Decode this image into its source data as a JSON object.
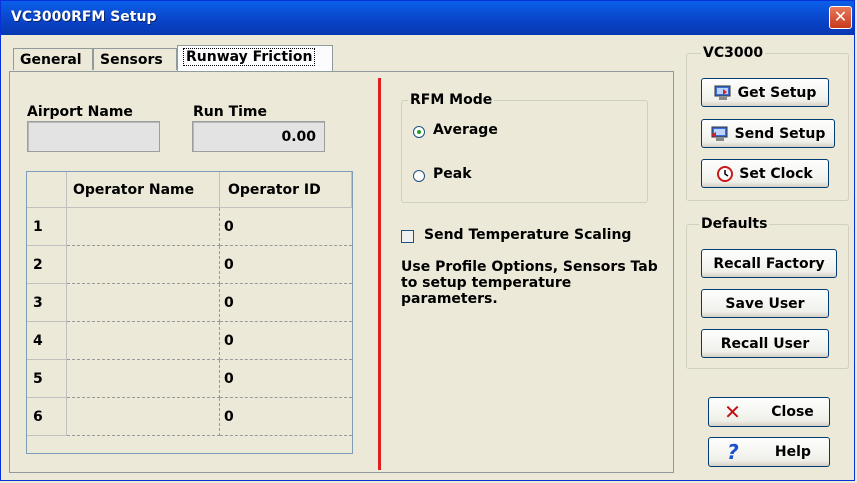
{
  "window": {
    "title": "VC3000RFM Setup",
    "close_glyph": "✕"
  },
  "tabs": [
    {
      "label": "General"
    },
    {
      "label": "Sensors"
    },
    {
      "label": "Runway Friction",
      "selected": true
    }
  ],
  "airport": {
    "label": "Airport Name",
    "value": ""
  },
  "runtime": {
    "label": "Run Time",
    "value": "0.00"
  },
  "grid": {
    "columns": [
      "",
      "Operator Name",
      "Operator ID"
    ],
    "rows": [
      {
        "num": "1",
        "name": "",
        "id": "0"
      },
      {
        "num": "2",
        "name": "",
        "id": "0"
      },
      {
        "num": "3",
        "name": "",
        "id": "0"
      },
      {
        "num": "4",
        "name": "",
        "id": "0"
      },
      {
        "num": "5",
        "name": "",
        "id": "0"
      },
      {
        "num": "6",
        "name": "",
        "id": "0"
      }
    ]
  },
  "rfm_mode": {
    "title": "RFM Mode",
    "options": [
      {
        "label": "Average",
        "selected": true
      },
      {
        "label": "Peak",
        "selected": false
      }
    ]
  },
  "temperature": {
    "checkbox_label": "Send Temperature Scaling",
    "checked": false,
    "info": "Use Profile Options, Sensors Tab to setup temperature parameters."
  },
  "vc3000": {
    "title": "VC3000",
    "buttons": [
      {
        "label": "Get Setup",
        "icon": "monitor-get-icon"
      },
      {
        "label": "Send Setup",
        "icon": "monitor-send-icon"
      },
      {
        "label": "Set Clock",
        "icon": "clock-icon"
      }
    ]
  },
  "defaults": {
    "title": "Defaults",
    "buttons": [
      {
        "label": "Recall Factory"
      },
      {
        "label": "Save User"
      },
      {
        "label": "Recall User"
      }
    ]
  },
  "footer_buttons": [
    {
      "label": "Close",
      "icon": "x-icon"
    },
    {
      "label": "Help",
      "icon": "question-icon"
    }
  ],
  "colors": {
    "titlebar": "#0a4fd8",
    "divider": "#e02020",
    "dialog_bg": "#ece9d8"
  }
}
